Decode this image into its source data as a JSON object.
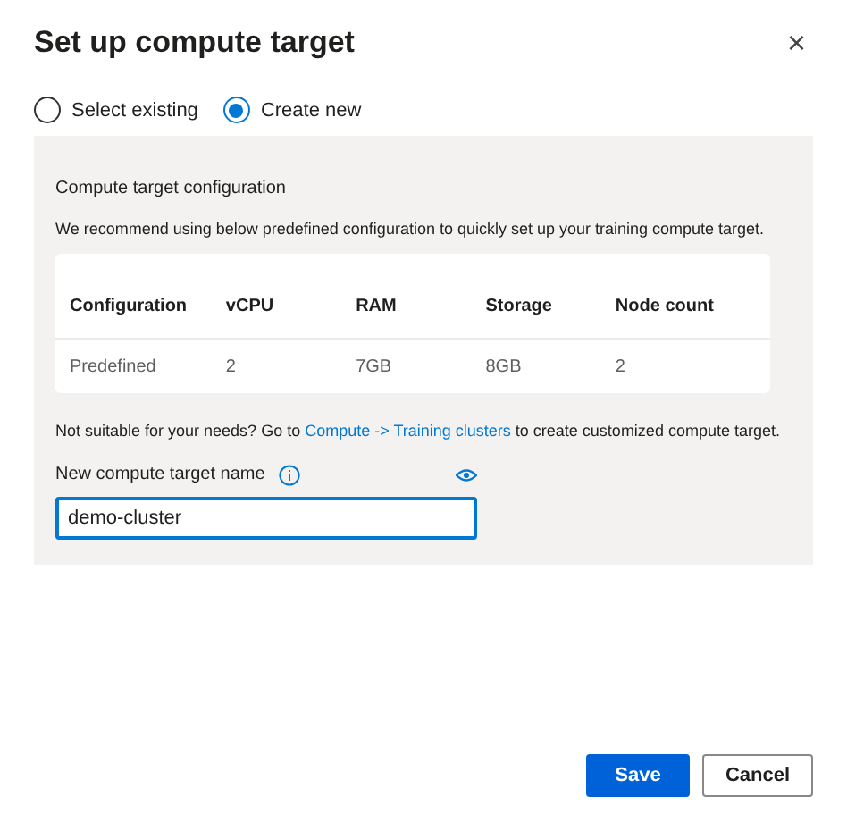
{
  "dialog": {
    "title": "Set up compute target",
    "close": "×"
  },
  "options": [
    {
      "label": "Select existing",
      "selected": false
    },
    {
      "label": "Create new",
      "selected": true
    }
  ],
  "panel": {
    "heading": "Compute target configuration",
    "description": "We recommend using below predefined configuration to quickly set up your training compute target.",
    "table": {
      "columns": [
        "Configuration",
        "vCPU",
        "RAM",
        "Storage",
        "Node count"
      ],
      "rows": [
        [
          "Predefined",
          "2",
          "7GB",
          "8GB",
          "2"
        ]
      ]
    },
    "note": {
      "before": "Not suitable for your needs? Go to ",
      "link": "Compute -> Training clusters",
      "after": " to create customized compute target."
    },
    "name_field": {
      "label": "New compute target name",
      "value": "demo-cluster"
    }
  },
  "buttons": [
    {
      "label": "Save",
      "kind": "primary"
    },
    {
      "label": "Cancel",
      "kind": "secondary"
    }
  ]
}
